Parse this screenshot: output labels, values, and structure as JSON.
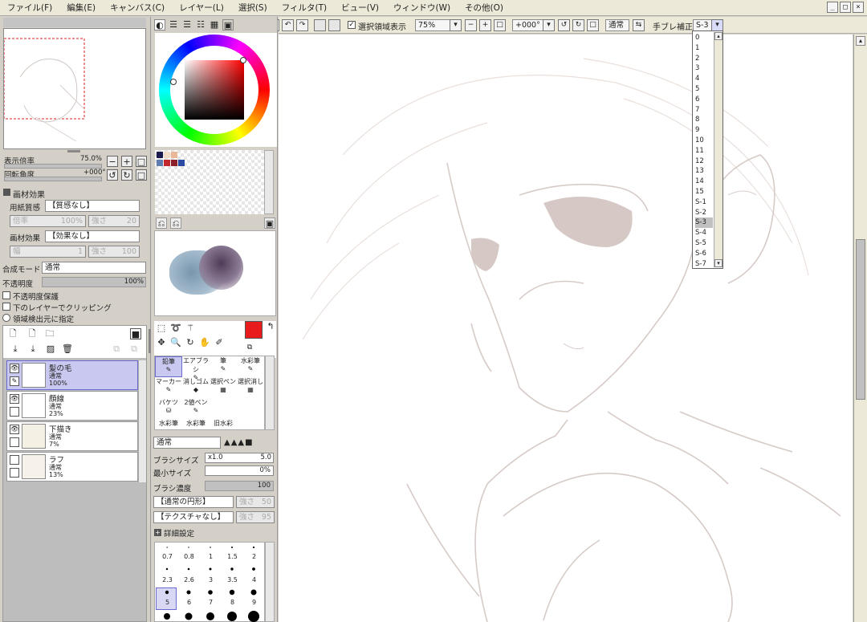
{
  "menu": [
    "ファイル(F)",
    "編集(E)",
    "キャンバス(C)",
    "レイヤー(L)",
    "選択(S)",
    "フィルタ(T)",
    "ビュー(V)",
    "ウィンドウ(W)",
    "その他(O)"
  ],
  "toolbar": {
    "selection_display": "選択領域表示",
    "zoom": "75%",
    "angle": "+000°",
    "blend": "通常",
    "stabilizer_label": "手ブレ補正",
    "stabilizer_value": "S-3"
  },
  "nav": {
    "zoom_label": "表示倍率",
    "zoom_value": "75.0%",
    "angle_label": "回転角度",
    "angle_value": "+000°"
  },
  "texture": {
    "header": "画材効果",
    "paper_label": "用紙質感",
    "paper_value": "【質感なし】",
    "scale_label": "倍率",
    "scale_value": "100%",
    "strength_label": "強さ",
    "strength_value": "20",
    "effect_label": "画材効果",
    "effect_value": "【効果なし】",
    "width_label": "幅",
    "width_value": "1",
    "intensity_label": "強さ",
    "intensity_value": "100"
  },
  "layer_props": {
    "blend_label": "合成モード",
    "blend_value": "通常",
    "opacity_label": "不透明度",
    "opacity_value": "100%",
    "opt1": "不透明度保護",
    "opt2": "下のレイヤーでクリッピング",
    "opt3": "領域検出元に指定"
  },
  "layers": [
    {
      "name": "髪の毛",
      "mode": "通常",
      "opacity": "100%"
    },
    {
      "name": "顔線",
      "mode": "通常",
      "opacity": "23%"
    },
    {
      "name": "下描き",
      "mode": "通常",
      "opacity": "7%"
    },
    {
      "name": "ラフ",
      "mode": "通常",
      "opacity": "13%"
    }
  ],
  "tools": [
    [
      "鉛筆",
      "エアブラシ",
      "筆",
      "水彩筆"
    ],
    [
      "マーカー",
      "消しゴム",
      "選択ペン",
      "選択消し"
    ],
    [
      "バケツ",
      "2値ペン",
      "",
      ""
    ],
    [
      "水彩筆",
      "水彩筆",
      "旧水彩",
      ""
    ]
  ],
  "brush": {
    "mode": "通常",
    "size_label": "ブラシサイズ",
    "size_mult": "x1.0",
    "size_value": "5.0",
    "min_label": "最小サイズ",
    "min_value": "0%",
    "density_label": "ブラシ濃度",
    "density_value": "100",
    "shape": "【通常の円形】",
    "shape_strength_label": "強さ",
    "shape_strength": "50",
    "texture": "【テクスチャなし】",
    "texture_strength_label": "強さ",
    "texture_strength": "95",
    "detail": "詳細設定"
  },
  "brush_sizes": [
    [
      "0.7",
      "0.8",
      "1",
      "1.5",
      "2"
    ],
    [
      "2.3",
      "2.6",
      "3",
      "3.5",
      "4"
    ],
    [
      "5",
      "6",
      "7",
      "8",
      "9"
    ]
  ],
  "stabilizer_options": [
    "0",
    "1",
    "2",
    "3",
    "4",
    "5",
    "6",
    "7",
    "8",
    "9",
    "10",
    "11",
    "12",
    "13",
    "14",
    "15",
    "S-1",
    "S-2",
    "S-3",
    "S-4",
    "S-5",
    "S-6",
    "S-7"
  ],
  "colors": {
    "current": "#e81c1c",
    "swatch1": "#1b1b4d",
    "swatch2": "#f3ddc6",
    "swatch3": "#e9b899",
    "swatch4": "#5f7fb3",
    "swatch5": "#c1272d",
    "swatch6": "#2d4aa3"
  }
}
